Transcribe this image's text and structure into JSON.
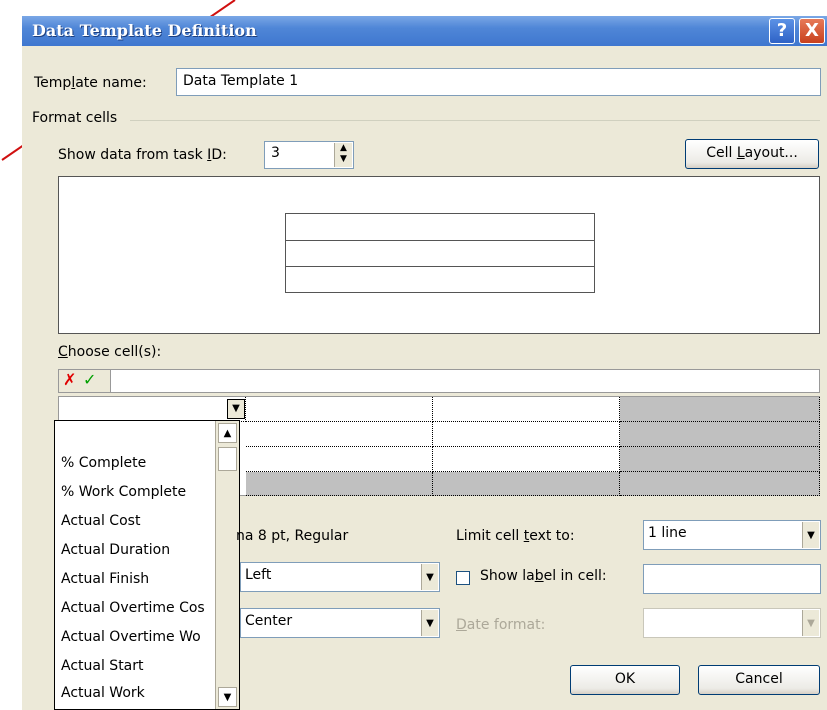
{
  "window": {
    "title": "Data Template Definition",
    "help_glyph": "?",
    "close_glyph": "X"
  },
  "template_name": {
    "label_pre": "Temp",
    "label_ul": "l",
    "label_post": "ate name:",
    "value": "Data Template 1"
  },
  "format_cells": {
    "label": "Format cells"
  },
  "task_id": {
    "label_pre": "Show data from task ",
    "label_ul": "I",
    "label_post": "D:",
    "value": "3"
  },
  "cell_layout_button": {
    "label_pre": "Cell ",
    "label_ul": "L",
    "label_post": "ayout..."
  },
  "choose_cells": {
    "label_ul": "C",
    "label_post": "hoose cell(s):",
    "cancel_glyph": "✗",
    "accept_glyph": "✓"
  },
  "field_list": {
    "items": [
      "% Complete",
      "% Work Complete",
      "Actual Cost",
      "Actual Duration",
      "Actual Finish",
      "Actual Overtime Cos",
      "Actual Overtime Wo",
      "Actual Start",
      "Actual Work"
    ]
  },
  "font_text": "na 8 pt, Regular",
  "h_align": {
    "value": "Left"
  },
  "v_align": {
    "value": "Center"
  },
  "limit_text": {
    "label_pre": "Limit cell ",
    "label_ul": "t",
    "label_post": "ext to:",
    "value": "1 line"
  },
  "show_label": {
    "label_pre": "Show la",
    "label_ul": "b",
    "label_post": "el in cell:",
    "value": ""
  },
  "date_format": {
    "label_ul": "D",
    "label_post": "ate format:"
  },
  "buttons": {
    "ok": "OK",
    "cancel": "Cancel"
  },
  "colors": {
    "titlebar": "#4f86d7",
    "dialog_bg": "#ece9d8",
    "cancel_x": "#e00000",
    "accept_check": "#00a000",
    "annotation_arrow": "#d01010"
  }
}
